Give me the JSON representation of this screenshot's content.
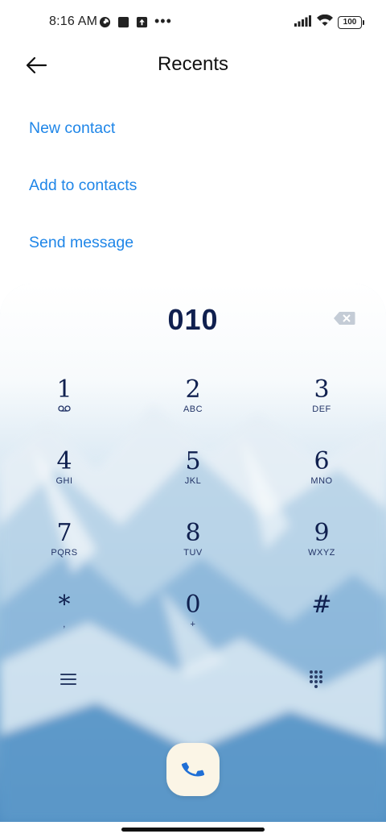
{
  "status_bar": {
    "time": "8:16 AM",
    "battery": "100",
    "icons_left": [
      "data-saver-icon",
      "square-notification-icon",
      "upload-notification-icon",
      "more-dots-icon"
    ],
    "icons_right": [
      "signal-icon",
      "wifi-icon",
      "battery-icon"
    ]
  },
  "header": {
    "title": "Recents",
    "back_icon": "back-arrow-icon"
  },
  "actions": [
    {
      "label": "New contact"
    },
    {
      "label": "Add to contacts"
    },
    {
      "label": "Send message"
    }
  ],
  "dialer": {
    "number": "010",
    "keys": [
      {
        "digit": "1",
        "letters": ""
      },
      {
        "digit": "2",
        "letters": "ABC"
      },
      {
        "digit": "3",
        "letters": "DEF"
      },
      {
        "digit": "4",
        "letters": "GHI"
      },
      {
        "digit": "5",
        "letters": "JKL"
      },
      {
        "digit": "6",
        "letters": "MNO"
      },
      {
        "digit": "7",
        "letters": "PQRS"
      },
      {
        "digit": "8",
        "letters": "TUV"
      },
      {
        "digit": "9",
        "letters": "WXYZ"
      },
      {
        "digit": "*",
        "letters": ","
      },
      {
        "digit": "0",
        "letters": "+"
      },
      {
        "digit": "#",
        "letters": ""
      }
    ],
    "colors": {
      "ink": "#10204f",
      "accent": "#1f86e8",
      "call_bg": "#fbf5e6",
      "call_icon": "#1f6fd6"
    }
  }
}
